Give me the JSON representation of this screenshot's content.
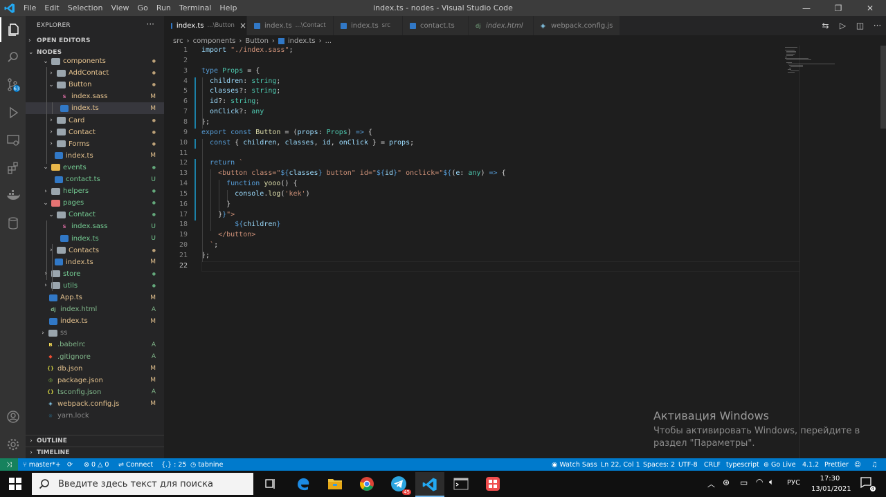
{
  "titlebar": {
    "menu": [
      "File",
      "Edit",
      "Selection",
      "View",
      "Go",
      "Run",
      "Terminal",
      "Help"
    ],
    "title": "index.ts - nodes - Visual Studio Code"
  },
  "sidebar": {
    "explorer_title": "EXPLORER",
    "open_editors": "OPEN EDITORS",
    "root": "NODES",
    "tree": [
      {
        "label": "components",
        "type": "folder",
        "depth": 1,
        "open": true,
        "status": "dot",
        "color": "#e2c08d"
      },
      {
        "label": "AddContact",
        "type": "folder",
        "depth": 2,
        "open": false,
        "status": "dot",
        "color": "#e2c08d"
      },
      {
        "label": "Button",
        "type": "folder",
        "depth": 2,
        "open": true,
        "status": "dot",
        "color": "#e2c08d"
      },
      {
        "label": "index.sass",
        "type": "sass",
        "depth": 3,
        "status": "M",
        "color": "#e2c08d"
      },
      {
        "label": "index.ts",
        "type": "ts",
        "depth": 3,
        "status": "M",
        "color": "#e2c08d",
        "selected": true
      },
      {
        "label": "Card",
        "type": "folder",
        "depth": 2,
        "open": false,
        "status": "dot",
        "color": "#e2c08d"
      },
      {
        "label": "Contact",
        "type": "folder",
        "depth": 2,
        "open": false,
        "status": "dot",
        "color": "#e2c08d"
      },
      {
        "label": "Forms",
        "type": "folder",
        "depth": 2,
        "open": false,
        "status": "dot",
        "color": "#e2c08d"
      },
      {
        "label": "index.ts",
        "type": "ts",
        "depth": 2,
        "status": "M",
        "color": "#e2c08d"
      },
      {
        "label": "events",
        "type": "folder",
        "depth": 1,
        "open": true,
        "status": "dot",
        "color": "#73c991"
      },
      {
        "label": "contact.ts",
        "type": "ts",
        "depth": 2,
        "status": "U",
        "color": "#73c991"
      },
      {
        "label": "helpers",
        "type": "folder",
        "depth": 1,
        "open": false,
        "status": "dot",
        "color": "#73c991"
      },
      {
        "label": "pages",
        "type": "folder",
        "depth": 1,
        "open": true,
        "status": "dot",
        "color": "#73c991"
      },
      {
        "label": "Contact",
        "type": "folder",
        "depth": 2,
        "open": true,
        "status": "dot",
        "color": "#73c991"
      },
      {
        "label": "index.sass",
        "type": "sass",
        "depth": 3,
        "status": "U",
        "color": "#73c991"
      },
      {
        "label": "index.ts",
        "type": "ts",
        "depth": 3,
        "status": "U",
        "color": "#73c991"
      },
      {
        "label": "Contacts",
        "type": "folder",
        "depth": 2,
        "open": false,
        "status": "dot",
        "color": "#e2c08d"
      },
      {
        "label": "index.ts",
        "type": "ts",
        "depth": 2,
        "status": "M",
        "color": "#e2c08d"
      },
      {
        "label": "store",
        "type": "folder",
        "depth": 1,
        "open": false,
        "status": "dot",
        "color": "#73c991"
      },
      {
        "label": "utils",
        "type": "folder",
        "depth": 1,
        "open": false,
        "status": "dot",
        "color": "#73c991"
      },
      {
        "label": "App.ts",
        "type": "ts",
        "depth": 1,
        "status": "M",
        "color": "#e2c08d"
      },
      {
        "label": "index.html",
        "type": "html",
        "depth": 1,
        "status": "A",
        "color": "#81b88b"
      },
      {
        "label": "index.ts",
        "type": "ts",
        "depth": 1,
        "status": "M",
        "color": "#e2c08d"
      },
      {
        "label": "ss",
        "type": "folder",
        "depth": 0,
        "open": false,
        "status": "",
        "color": "#8b8b8b"
      },
      {
        "label": ".babelrc",
        "type": "babel",
        "depth": 0,
        "status": "A",
        "color": "#81b88b"
      },
      {
        "label": ".gitignore",
        "type": "git",
        "depth": 0,
        "status": "A",
        "color": "#81b88b"
      },
      {
        "label": "db.json",
        "type": "json",
        "depth": 0,
        "status": "M",
        "color": "#e2c08d"
      },
      {
        "label": "package.json",
        "type": "npm",
        "depth": 0,
        "status": "M",
        "color": "#e2c08d"
      },
      {
        "label": "tsconfig.json",
        "type": "json",
        "depth": 0,
        "status": "A",
        "color": "#81b88b"
      },
      {
        "label": "webpack.config.js",
        "type": "webpack",
        "depth": 0,
        "status": "M",
        "color": "#e2c08d"
      },
      {
        "label": "yarn.lock",
        "type": "yarn",
        "depth": 0,
        "status": "",
        "color": "#8b8b8b"
      }
    ],
    "outline": "OUTLINE",
    "timeline": "TIMELINE"
  },
  "tabs": [
    {
      "label": "index.ts",
      "sub": "...\\Button",
      "icon": "ts",
      "active": true,
      "close": "×"
    },
    {
      "label": "index.ts",
      "sub": "...\\Contact",
      "icon": "ts"
    },
    {
      "label": "index.ts",
      "sub": "src",
      "icon": "ts"
    },
    {
      "label": "contact.ts",
      "sub": "",
      "icon": "ts"
    },
    {
      "label": "index.html",
      "sub": "",
      "icon": "html"
    },
    {
      "label": "webpack.config.js",
      "sub": "",
      "icon": "webpack"
    }
  ],
  "breadcrumb": [
    "src",
    "components",
    "Button",
    "index.ts",
    "..."
  ],
  "code": [
    [
      [
        "import ",
        "v"
      ],
      [
        "\"./index.sass\"",
        "s"
      ],
      [
        ";",
        "p"
      ]
    ],
    [],
    [
      [
        "type ",
        "k"
      ],
      [
        "Props",
        "t"
      ],
      [
        " = {",
        "p"
      ]
    ],
    [
      [
        "  children",
        "v"
      ],
      [
        ": ",
        "p"
      ],
      [
        "string",
        "t"
      ],
      [
        ";",
        "p"
      ]
    ],
    [
      [
        "  classes",
        "v"
      ],
      [
        "?: ",
        "p"
      ],
      [
        "string",
        "t"
      ],
      [
        ";",
        "p"
      ]
    ],
    [
      [
        "  id",
        "v"
      ],
      [
        "?: ",
        "p"
      ],
      [
        "string",
        "t"
      ],
      [
        ";",
        "p"
      ]
    ],
    [
      [
        "  onClick",
        "v"
      ],
      [
        "?: ",
        "p"
      ],
      [
        "any",
        "t"
      ]
    ],
    [
      [
        "};",
        "p"
      ]
    ],
    [
      [
        "export ",
        "k"
      ],
      [
        "const ",
        "k"
      ],
      [
        "Button",
        "f"
      ],
      [
        " = (",
        "p"
      ],
      [
        "props",
        "v"
      ],
      [
        ": ",
        "p"
      ],
      [
        "Props",
        "t"
      ],
      [
        ") ",
        "p"
      ],
      [
        "=>",
        "k"
      ],
      [
        " {",
        "p"
      ]
    ],
    [
      [
        "  ",
        "p"
      ],
      [
        "const ",
        "k"
      ],
      [
        "{ ",
        "p"
      ],
      [
        "children",
        "v"
      ],
      [
        ", ",
        "p"
      ],
      [
        "classes",
        "v"
      ],
      [
        ", ",
        "p"
      ],
      [
        "id",
        "v"
      ],
      [
        ", ",
        "p"
      ],
      [
        "onClick",
        "v"
      ],
      [
        " } = ",
        "p"
      ],
      [
        "props",
        "v"
      ],
      [
        ";",
        "p"
      ]
    ],
    [],
    [
      [
        "  ",
        "p"
      ],
      [
        "return ",
        "k"
      ],
      [
        "`",
        "s"
      ]
    ],
    [
      [
        "    <button class=\"",
        "s"
      ],
      [
        "${",
        "k"
      ],
      [
        "classes",
        "v"
      ],
      [
        "}",
        "k"
      ],
      [
        " button\" id=\"",
        "s"
      ],
      [
        "${",
        "k"
      ],
      [
        "id",
        "v"
      ],
      [
        "}",
        "k"
      ],
      [
        "\" onclick=\"",
        "s"
      ],
      [
        "${",
        "k"
      ],
      [
        "(",
        "p"
      ],
      [
        "e",
        "v"
      ],
      [
        ": ",
        "p"
      ],
      [
        "any",
        "t"
      ],
      [
        ") ",
        "p"
      ],
      [
        "=>",
        "k"
      ],
      [
        " {",
        "p"
      ]
    ],
    [
      [
        "      ",
        "p"
      ],
      [
        "function ",
        "k"
      ],
      [
        "yooo",
        "f"
      ],
      [
        "() {",
        "p"
      ]
    ],
    [
      [
        "        ",
        "p"
      ],
      [
        "console",
        "v"
      ],
      [
        ".",
        "p"
      ],
      [
        "log",
        "f"
      ],
      [
        "(",
        "p"
      ],
      [
        "'kek'",
        "s"
      ],
      [
        ")",
        "p"
      ]
    ],
    [
      [
        "      }",
        "p"
      ]
    ],
    [
      [
        "    }",
        "p"
      ],
      [
        "}",
        "k"
      ],
      [
        "\">",
        "s"
      ]
    ],
    [
      [
        "        ",
        "p"
      ],
      [
        "${",
        "k"
      ],
      [
        "children",
        "v"
      ],
      [
        "}",
        "k"
      ]
    ],
    [
      [
        "    </button>",
        "s"
      ]
    ],
    [
      [
        "  `",
        "s"
      ],
      [
        ";",
        "p"
      ]
    ],
    [
      [
        "};",
        "p"
      ]
    ],
    []
  ],
  "watermark": {
    "title": "Активация Windows",
    "line1": "Чтобы активировать Windows, перейдите в",
    "line2": "раздел \"Параметры\"."
  },
  "status": {
    "branch": "master*+",
    "sync": "",
    "errors": "0",
    "warnings": "0",
    "connect": "Connect",
    "position_hint": "{.} : 25",
    "tabnine": "tabnine",
    "watch_sass": "Watch Sass",
    "ln_col": "Ln 22, Col 1",
    "spaces": "Spaces: 2",
    "encoding": "UTF-8",
    "eol": "CRLF",
    "language": "typescript",
    "go_live": "Go Live",
    "version": "4.1.2",
    "prettier": "Prettier"
  },
  "taskbar": {
    "search_placeholder": "Введите здесь текст для поиска",
    "lang": "РУС",
    "time": "17:30",
    "date": "13/01/2021",
    "notifications": "4",
    "telegram_badge": "45"
  },
  "colors": {
    "accent": "#007acc",
    "ts_blue": "#3178c6",
    "modified": "#e2c08d",
    "untracked": "#73c991"
  }
}
